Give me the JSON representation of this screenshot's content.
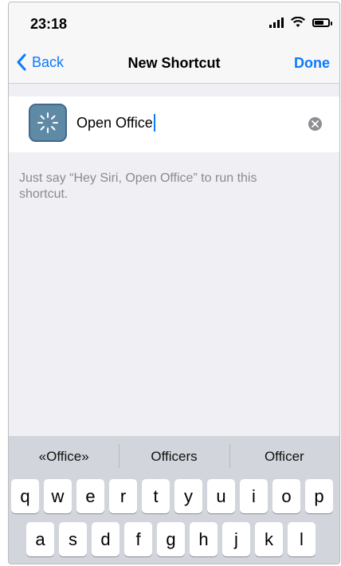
{
  "status_bar": {
    "time": "23:18",
    "battery_level": 0.7
  },
  "nav": {
    "back_label": "Back",
    "title": "New Shortcut",
    "done_label": "Done"
  },
  "shortcut": {
    "name_value": "Open Office",
    "icon": "magic-wand-sparkle-icon",
    "icon_color": "#5f8aa6"
  },
  "hint": "Just say “Hey Siri, Open Office” to run this shortcut.",
  "keyboard": {
    "suggestions": [
      "«Office»",
      "Officers",
      "Officer"
    ],
    "row1": [
      "q",
      "w",
      "e",
      "r",
      "t",
      "y",
      "u",
      "i",
      "o",
      "p"
    ],
    "row2": [
      "a",
      "s",
      "d",
      "f",
      "g",
      "h",
      "j",
      "k",
      "l"
    ]
  },
  "colors": {
    "accent": "#0a7aff",
    "background": "#efeff4",
    "keyboard": "#d2d5db"
  }
}
